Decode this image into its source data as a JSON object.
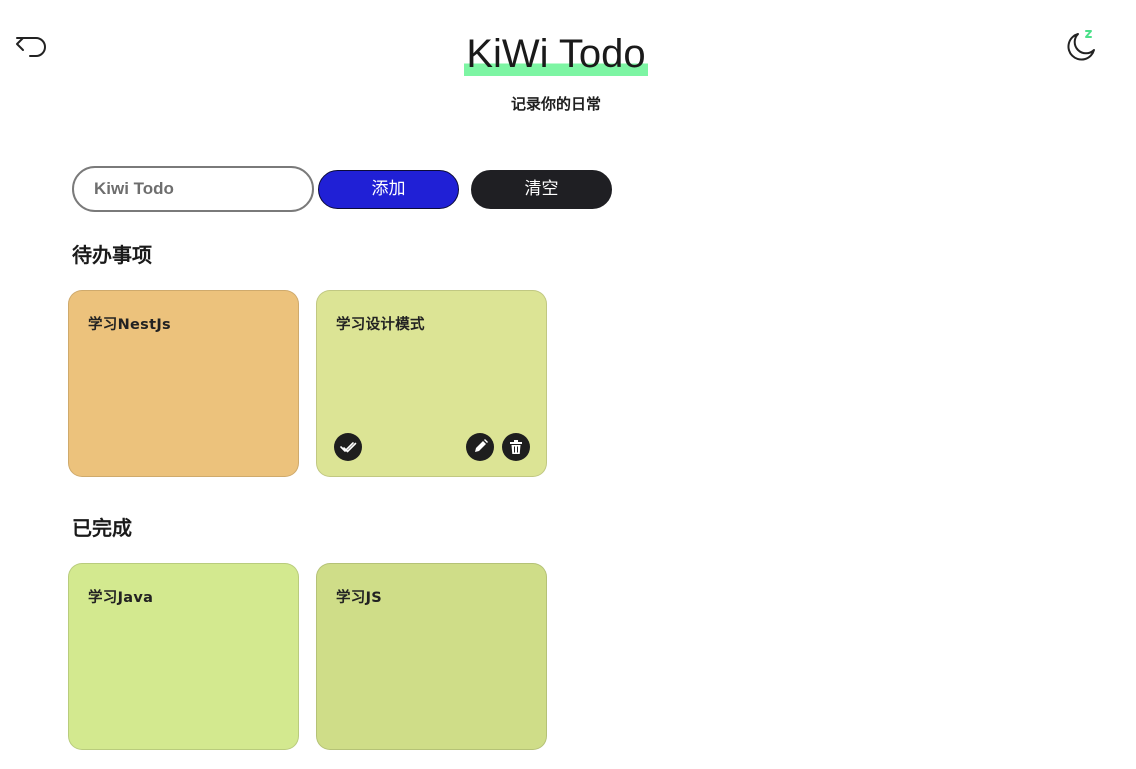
{
  "header": {
    "title": "KiWi Todo",
    "subtitle": "记录你的日常",
    "back_icon": "undo-arrow-icon",
    "theme_icon": "moon-sleep-icon",
    "title_highlight_color": "#7df5a3"
  },
  "form": {
    "input_placeholder": "Kiwi Todo",
    "add_label": "添加",
    "clear_label": "清空",
    "add_color": "#2020d6",
    "clear_color": "#1f1f23"
  },
  "pending": {
    "title": "待办事项",
    "items": [
      {
        "text": "学习NestJs",
        "color": "#ecc27c"
      },
      {
        "text": "学习设计模式",
        "color": "#dce495"
      }
    ]
  },
  "done": {
    "title": "已完成",
    "items": [
      {
        "text": "学习Java",
        "color": "#d3e98f"
      },
      {
        "text": "学习JS",
        "color": "#cfdd88"
      }
    ]
  },
  "card_actions": {
    "complete_icon": "double-check-icon",
    "edit_icon": "pencil-icon",
    "delete_icon": "trash-icon"
  }
}
